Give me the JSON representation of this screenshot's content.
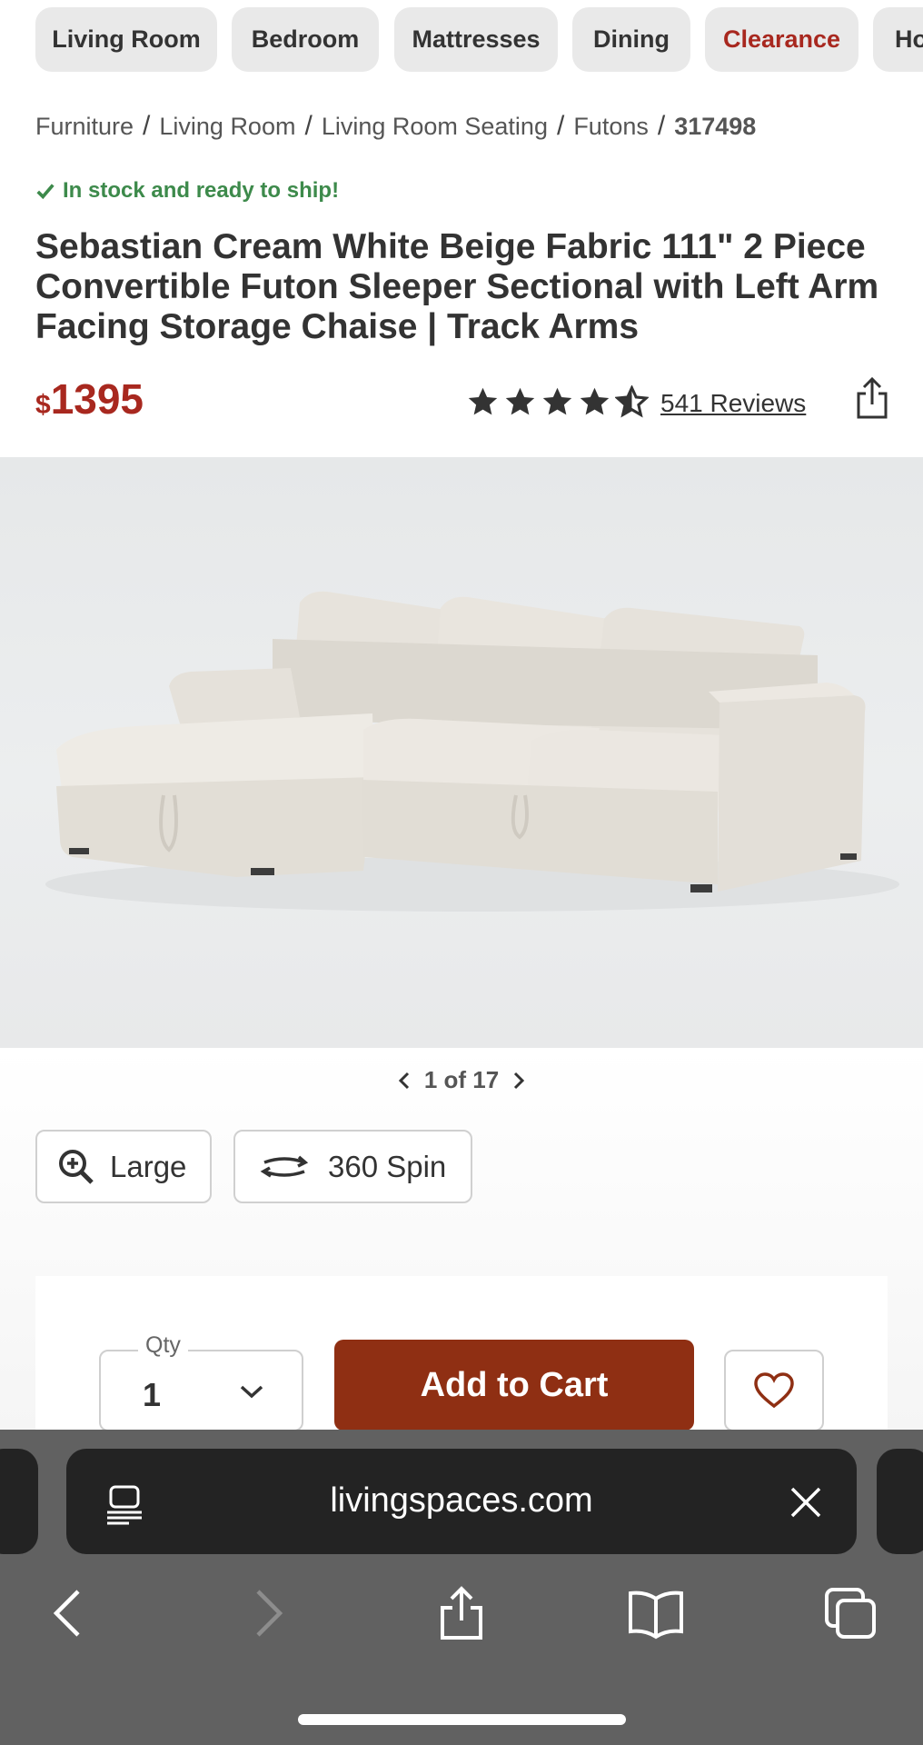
{
  "categories": [
    {
      "label": "Living Room",
      "highlight": false
    },
    {
      "label": "Bedroom",
      "highlight": false
    },
    {
      "label": "Mattresses",
      "highlight": false
    },
    {
      "label": "Dining",
      "highlight": false
    },
    {
      "label": "Clearance",
      "highlight": true
    },
    {
      "label": "Ho",
      "highlight": false
    }
  ],
  "breadcrumb": [
    "Furniture",
    "Living Room",
    "Living Room Seating",
    "Futons",
    "317498"
  ],
  "stock_status": "In stock and ready to ship!",
  "product": {
    "title": "Sebastian Cream White Beige Fabric 111\" 2 Piece Convertible Futon Sleeper Sectional with Left Arm Facing Storage Chaise | Track Arms",
    "currency": "$",
    "price": "1395",
    "rating": 4.5,
    "reviews_label": "541 Reviews"
  },
  "gallery": {
    "pager": "1 of 17"
  },
  "view_buttons": {
    "large": "Large",
    "spin": "360 Spin"
  },
  "purchase": {
    "qty_label": "Qty",
    "qty_value": "1",
    "cart_label": "Add to Cart"
  },
  "browser": {
    "url": "livingspaces.com"
  },
  "colors": {
    "brand_red": "#a8281f",
    "cart_button": "#8f2f13",
    "stock_green": "#3d8a4b",
    "browser_chrome": "#616161"
  },
  "icons": [
    "check-icon",
    "star-icon",
    "star-half-icon",
    "share-icon",
    "chevron-left-icon",
    "chevron-right-icon",
    "zoom-in-icon",
    "spin-360-icon",
    "chevron-down-icon",
    "heart-icon",
    "reader-icon",
    "close-icon",
    "back-icon",
    "forward-icon",
    "bookmarks-icon",
    "tabs-icon"
  ]
}
